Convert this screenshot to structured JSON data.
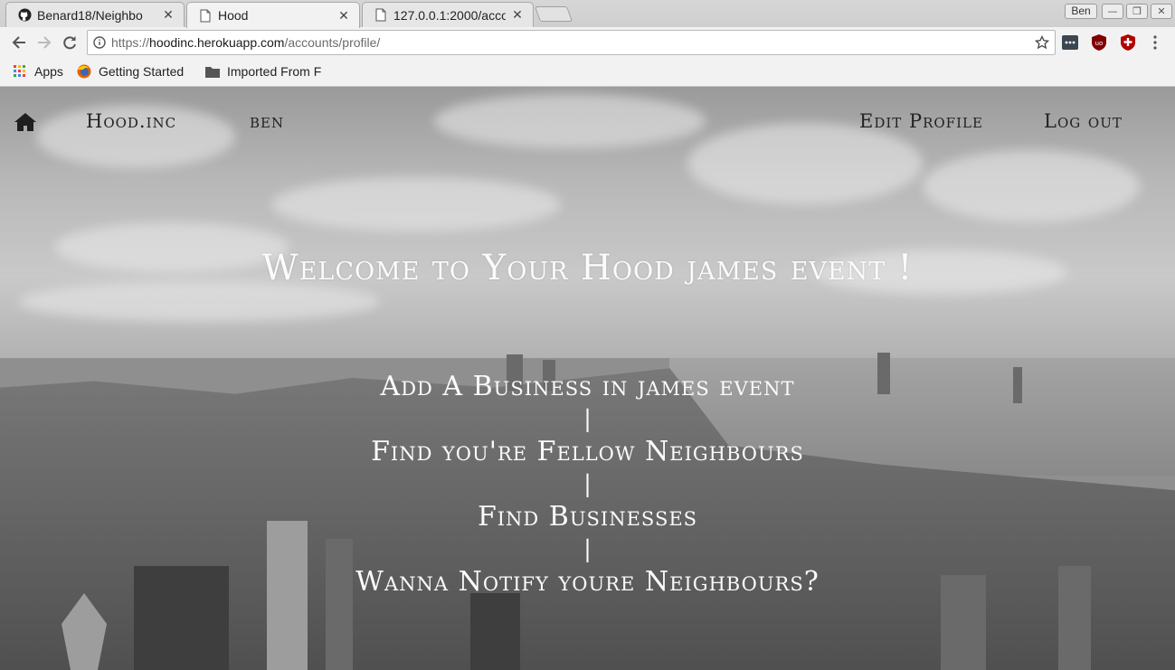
{
  "browser": {
    "tabs": [
      {
        "title": "Benard18/Neighbo",
        "icon": "github-icon",
        "active": false
      },
      {
        "title": "Hood",
        "icon": "page-icon",
        "active": true
      },
      {
        "title": "127.0.0.1:2000/acco",
        "icon": "page-icon",
        "active": false
      }
    ],
    "tab_close": "✕",
    "window": {
      "user_label": "Ben",
      "minimize": "—",
      "restore": "❐",
      "close": "✕"
    },
    "address": {
      "proto": "https://",
      "host": "hoodinc.herokuapp.com",
      "path": "/accounts/profile/"
    },
    "bookmarks": [
      {
        "label": "Apps",
        "icon": "apps-grid-icon"
      },
      {
        "label": "Getting Started",
        "icon": "firefox-icon"
      },
      {
        "label": "Imported From F",
        "icon": "folder-icon"
      }
    ],
    "extensions": [
      "extension-icon",
      "ublock-icon",
      "shield-icon"
    ]
  },
  "site": {
    "nav": {
      "home_icon": "home-icon",
      "brand": "Hood.inc",
      "user": "ben",
      "edit_profile": "Edit Profile",
      "logout": "Log out"
    },
    "welcome": "Welcome to Your Hood james event !",
    "links": [
      "Add A Business in james event",
      "Find you're Fellow Neighbours",
      "Find Businesses",
      "Wanna Notify youre Neighbours?"
    ],
    "separator": "|"
  },
  "colors": {
    "hero_text": "#fbfbfb",
    "nav_text": "#222222",
    "chrome_bg": "#f2f2f2"
  }
}
